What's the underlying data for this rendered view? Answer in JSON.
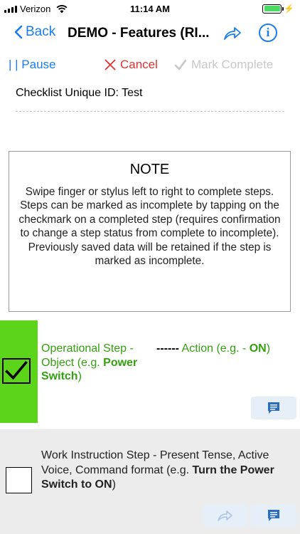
{
  "status_bar": {
    "carrier": "Verizon",
    "time": "11:14 AM",
    "battery_level": 1.0
  },
  "nav": {
    "back_label": "Back",
    "title": "DEMO - Features (RI..."
  },
  "toolbar": {
    "pause_label": "| | Pause",
    "cancel_label": "Cancel",
    "complete_label": "Mark Complete"
  },
  "checklist": {
    "unique_id_label": "Checklist Unique ID: Test"
  },
  "note": {
    "title": "NOTE",
    "line1": "Swipe finger or stylus left to right to complete steps.",
    "line2": "Steps can be marked as incomplete by tapping on the checkmark on a completed step (requires confirmation to change a step status from complete to incomplete).",
    "line3": "Previously saved data will be retained if the step is marked as incomplete."
  },
  "steps": [
    {
      "status": "complete",
      "text_prefix": "Operational Step - Object (e.g. ",
      "text_bold": "Power Switch",
      "text_suffix": ")",
      "action_dashes": "------",
      "action_prefix": " Action (e.g. - ",
      "action_bold": "ON",
      "action_suffix": ")"
    },
    {
      "status": "incomplete",
      "text_prefix": "Work Instruction Step - Present Tense, Active Voice, Command format (e.g. ",
      "text_bold": "Turn the Power Switch to ON",
      "text_suffix": ")"
    }
  ],
  "colors": {
    "accent": "#1a7cf0",
    "cancel": "#e03131",
    "complete_green": "#5bd419",
    "step_text_green": "#33a00f",
    "disabled": "#c8c8c8"
  },
  "icons": {
    "back": "chevron-left-icon",
    "share": "share-arrow-icon",
    "info": "info-icon",
    "cancel": "x-icon",
    "complete": "checkmark-icon",
    "comment": "comment-icon"
  }
}
